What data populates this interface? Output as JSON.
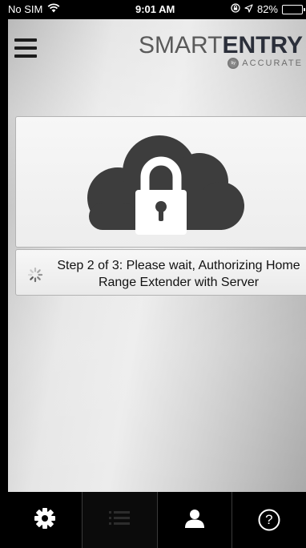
{
  "status_bar": {
    "carrier": "No SIM",
    "time": "9:01 AM",
    "battery_percent": "82%",
    "battery_level": 0.82
  },
  "header": {
    "brand_thin": "SMART",
    "brand_bold": "ENTRY",
    "brand_sub": "ACCURATE",
    "brand_by": "by"
  },
  "status": {
    "message": "Step 2 of 3: Please wait, Authorizing Home Range Extender  with Server"
  },
  "tabs": [
    {
      "icon": "gear-icon"
    },
    {
      "icon": "list-icon"
    },
    {
      "icon": "person-icon"
    },
    {
      "icon": "help-icon",
      "label": "?"
    }
  ],
  "colors": {
    "cloud": "#3d3d3d",
    "lock": "#ffffff",
    "tab_bar": "#000000",
    "brand_bold": "#2b2f3a"
  }
}
